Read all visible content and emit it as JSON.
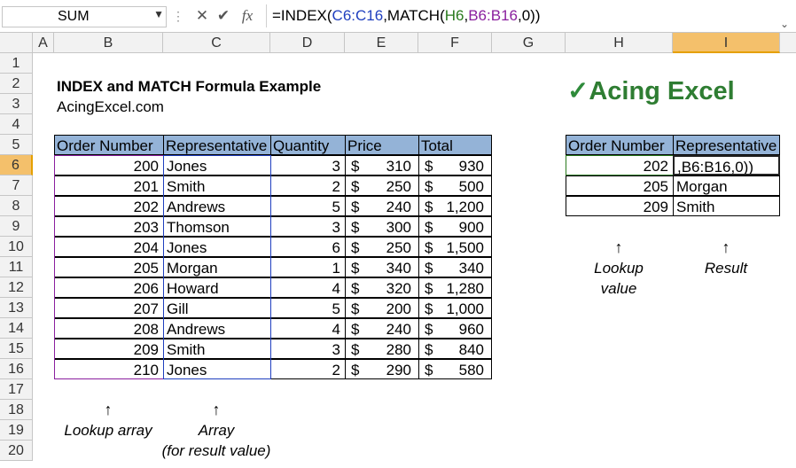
{
  "formula_bar": {
    "name_box": "SUM",
    "cancel_icon": "x-icon",
    "enter_icon": "check-icon",
    "fx_label": "fx",
    "formula_prefix": "=INDEX(",
    "formula_ref1": "C6:C16",
    "formula_mid": ",MATCH(",
    "formula_ref2": "H6",
    "formula_comma": ",",
    "formula_ref3": "B6:B16",
    "formula_suffix": ",0))"
  },
  "columns": [
    "A",
    "B",
    "C",
    "D",
    "E",
    "F",
    "G",
    "H",
    "I"
  ],
  "rows": [
    "1",
    "2",
    "3",
    "4",
    "5",
    "6",
    "7",
    "8",
    "9",
    "10",
    "11",
    "12",
    "13",
    "14",
    "15",
    "16",
    "17",
    "18",
    "19",
    "20"
  ],
  "sheet": {
    "title": "INDEX and MATCH Formula Example",
    "site": "AcingExcel.com",
    "logo": "Acing Excel",
    "logo_check": "✓",
    "table_headers": [
      "Order Number",
      "Representative",
      "Quantity",
      "Price",
      "Total"
    ],
    "table_rows": [
      {
        "order": "200",
        "rep": "Jones",
        "qty": "3",
        "price": "310",
        "total": "930"
      },
      {
        "order": "201",
        "rep": "Smith",
        "qty": "2",
        "price": "250",
        "total": "500"
      },
      {
        "order": "202",
        "rep": "Andrews",
        "qty": "5",
        "price": "240",
        "total": "1,200"
      },
      {
        "order": "203",
        "rep": "Thomson",
        "qty": "3",
        "price": "300",
        "total": "900"
      },
      {
        "order": "204",
        "rep": "Jones",
        "qty": "6",
        "price": "250",
        "total": "1,500"
      },
      {
        "order": "205",
        "rep": "Morgan",
        "qty": "1",
        "price": "340",
        "total": "340"
      },
      {
        "order": "206",
        "rep": "Howard",
        "qty": "4",
        "price": "320",
        "total": "1,280"
      },
      {
        "order": "207",
        "rep": "Gill",
        "qty": "5",
        "price": "200",
        "total": "1,000"
      },
      {
        "order": "208",
        "rep": "Andrews",
        "qty": "4",
        "price": "240",
        "total": "960"
      },
      {
        "order": "209",
        "rep": "Smith",
        "qty": "3",
        "price": "280",
        "total": "840"
      },
      {
        "order": "210",
        "rep": "Jones",
        "qty": "2",
        "price": "290",
        "total": "580"
      }
    ],
    "currency": "$",
    "lookup_headers": [
      "Order Number",
      "Representative"
    ],
    "lookup_rows": [
      {
        "order": "202",
        "rep": ",B6:B16,0))"
      },
      {
        "order": "205",
        "rep": "Morgan"
      },
      {
        "order": "209",
        "rep": "Smith"
      }
    ],
    "arrow": "↑",
    "note_lookup_array": "Lookup array",
    "note_array": "Array",
    "note_array_sub": "(for result value)",
    "note_lookup_value_1": "Lookup",
    "note_lookup_value_2": "value",
    "note_result": "Result"
  },
  "colors": {
    "header_fill": "#94b3d7",
    "selected_header": "#f4c06b",
    "logo": "#2e8b3a"
  }
}
